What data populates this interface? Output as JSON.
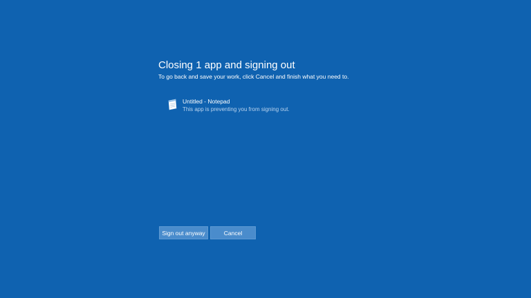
{
  "dialog": {
    "title": "Closing 1 app and signing out",
    "instruction": "To go back and save your work, click Cancel and finish what you need to."
  },
  "apps": [
    {
      "name": "Untitled - Notepad",
      "status": "This app is preventing you from signing out.",
      "icon": "notepad-icon"
    }
  ],
  "buttons": {
    "sign_out_label": "Sign out anyway",
    "cancel_label": "Cancel"
  },
  "colors": {
    "background": "#0f62b0",
    "button": "#4a8ccc",
    "secondary_text": "#b9d3ee"
  }
}
